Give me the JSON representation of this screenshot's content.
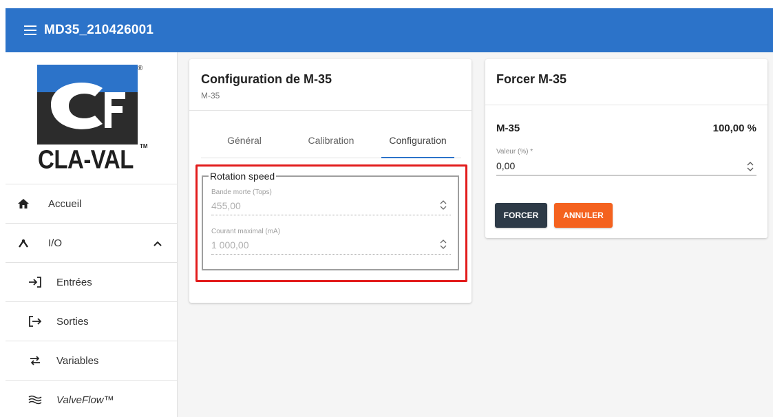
{
  "appbar": {
    "title": "MD35_210426001"
  },
  "logo": {
    "brand": "CLA-VAL",
    "tm": "TM",
    "reg": "®"
  },
  "sidebar": {
    "items": [
      {
        "label": "Accueil",
        "icon": "home-icon"
      },
      {
        "label": "I/O",
        "icon": "io-icon",
        "expanded": true
      },
      {
        "label": "Entrées",
        "icon": "input-icon"
      },
      {
        "label": "Sorties",
        "icon": "output-icon"
      },
      {
        "label": "Variables",
        "icon": "swap-icon"
      },
      {
        "label": "ValveFlow™",
        "icon": "waves-icon"
      }
    ]
  },
  "config_card": {
    "title": "Configuration de M-35",
    "subtitle": "M-35",
    "tabs": [
      {
        "label": "Général"
      },
      {
        "label": "Calibration"
      },
      {
        "label": "Configuration",
        "active": true
      }
    ],
    "group": {
      "legend": "Rotation speed",
      "fields": [
        {
          "label": "Bande morte (Tops)",
          "value": "455,00"
        },
        {
          "label": "Courant maximal (mA)",
          "value": "1 000,00"
        }
      ]
    }
  },
  "force_card": {
    "title": "Forcer M-35",
    "device": "M-35",
    "percent": "100,00 %",
    "value_label": "Valeur (%) *",
    "value": "0,00",
    "force_button": "FORCER",
    "cancel_button": "ANNULER"
  },
  "colors": {
    "appbar": "#2c73c9",
    "tab_indicator": "#2c73c9",
    "highlight": "#e21b1b",
    "force_button": "#2d3a47",
    "cancel_button": "#f4621f"
  }
}
